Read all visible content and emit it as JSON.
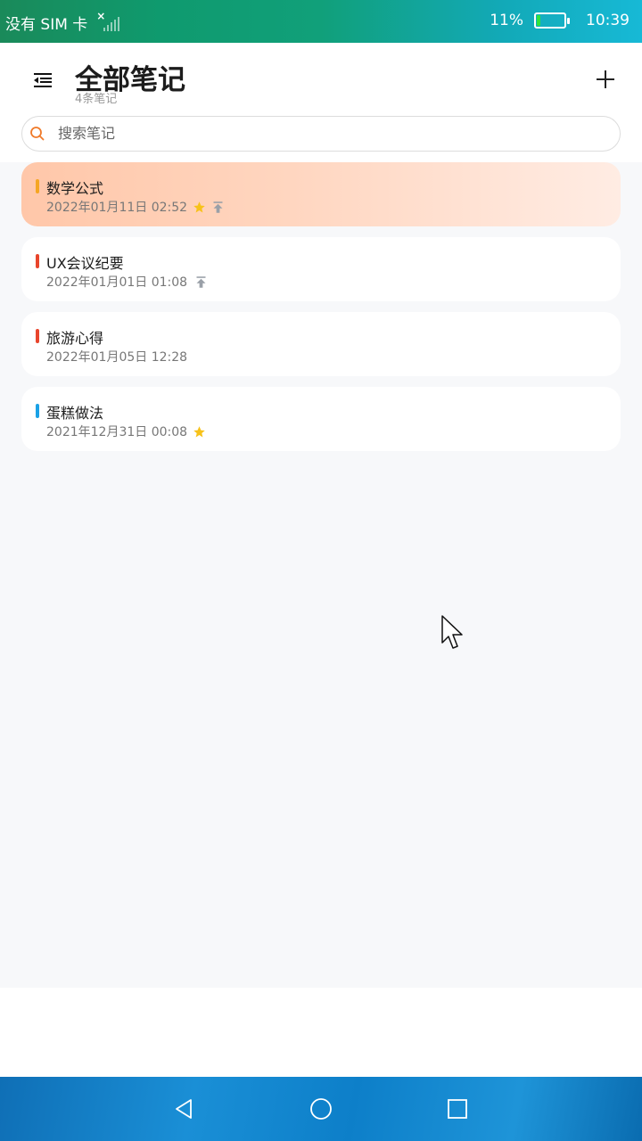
{
  "status_bar": {
    "carrier": "没有 SIM 卡",
    "battery_percent": "11%",
    "battery_level": 0.11,
    "time": "10:39"
  },
  "header": {
    "title": "全部笔记",
    "subtitle": "4条笔记"
  },
  "search": {
    "placeholder": "搜索笔记"
  },
  "notes": [
    {
      "title": "数学公式",
      "date": "2022年01月11日 02:52",
      "color": "#f5a623",
      "starred": true,
      "pinned": true,
      "active": true
    },
    {
      "title": "UX会议纪要",
      "date": "2022年01月01日 01:08",
      "color": "#e8452c",
      "starred": false,
      "pinned": true,
      "active": false
    },
    {
      "title": "旅游心得",
      "date": "2022年01月05日 12:28",
      "color": "#e8452c",
      "starred": false,
      "pinned": false,
      "active": false
    },
    {
      "title": "蛋糕做法",
      "date": "2021年12月31日 00:08",
      "color": "#1aa1e6",
      "starred": true,
      "pinned": false,
      "active": false
    }
  ],
  "colors": {
    "star": "#f7c21a",
    "pin": "#9aa0a8",
    "accent_search": "#f07a2a"
  },
  "icons": {
    "menu": "menu-collapse-icon",
    "add": "plus-icon",
    "search": "search-icon",
    "star": "star-icon",
    "pin": "pin-top-icon",
    "back": "back-triangle-icon",
    "home": "home-circle-icon",
    "recents": "recents-square-icon"
  }
}
